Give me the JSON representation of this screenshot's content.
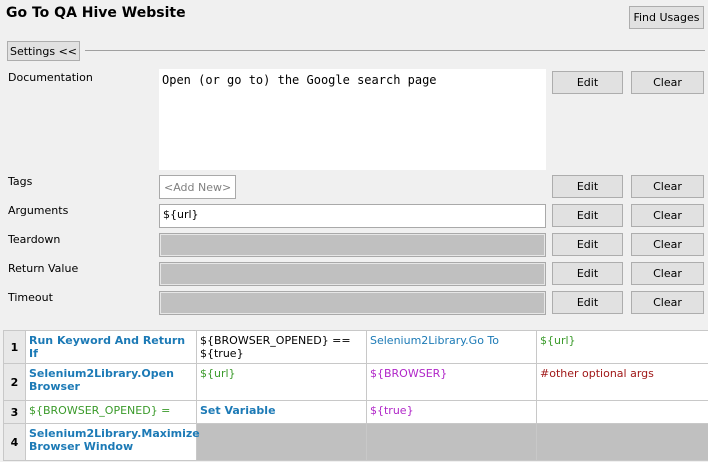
{
  "header": {
    "title": "Go To QA Hive Website",
    "find_usages_label": "Find Usages"
  },
  "settings": {
    "toggle_label": "Settings <<",
    "documentation": {
      "label": "Documentation",
      "value": "Open (or go to) the Google search page"
    },
    "tags": {
      "label": "Tags",
      "add_new": "<Add New>"
    },
    "arguments": {
      "label": "Arguments",
      "value": "${url}"
    },
    "teardown": {
      "label": "Teardown"
    },
    "return_value": {
      "label": "Return Value"
    },
    "timeout": {
      "label": "Timeout"
    },
    "edit_label": "Edit",
    "clear_label": "Clear"
  },
  "grid": {
    "rows": [
      {
        "num": "1",
        "cells": [
          "Run Keyword And Return If",
          "${BROWSER_OPENED} == ${true}",
          "Selenium2Library.Go To",
          "${url}"
        ]
      },
      {
        "num": "2",
        "cells": [
          "Selenium2Library.Open Browser",
          "${url}",
          "${BROWSER}",
          "#other optional args"
        ]
      },
      {
        "num": "3",
        "cells": [
          "${BROWSER_OPENED} =",
          "Set Variable",
          "${true}",
          ""
        ]
      },
      {
        "num": "4",
        "cells": [
          "Selenium2Library.Maximize Browser Window",
          "",
          "",
          ""
        ]
      }
    ]
  },
  "colors": {
    "keyword": "#1c7ab6",
    "variable_green": "#3a9a2a",
    "variable_purple": "#b026c8",
    "comment": "#a01818",
    "disabled_field": "#c0c0c0"
  }
}
